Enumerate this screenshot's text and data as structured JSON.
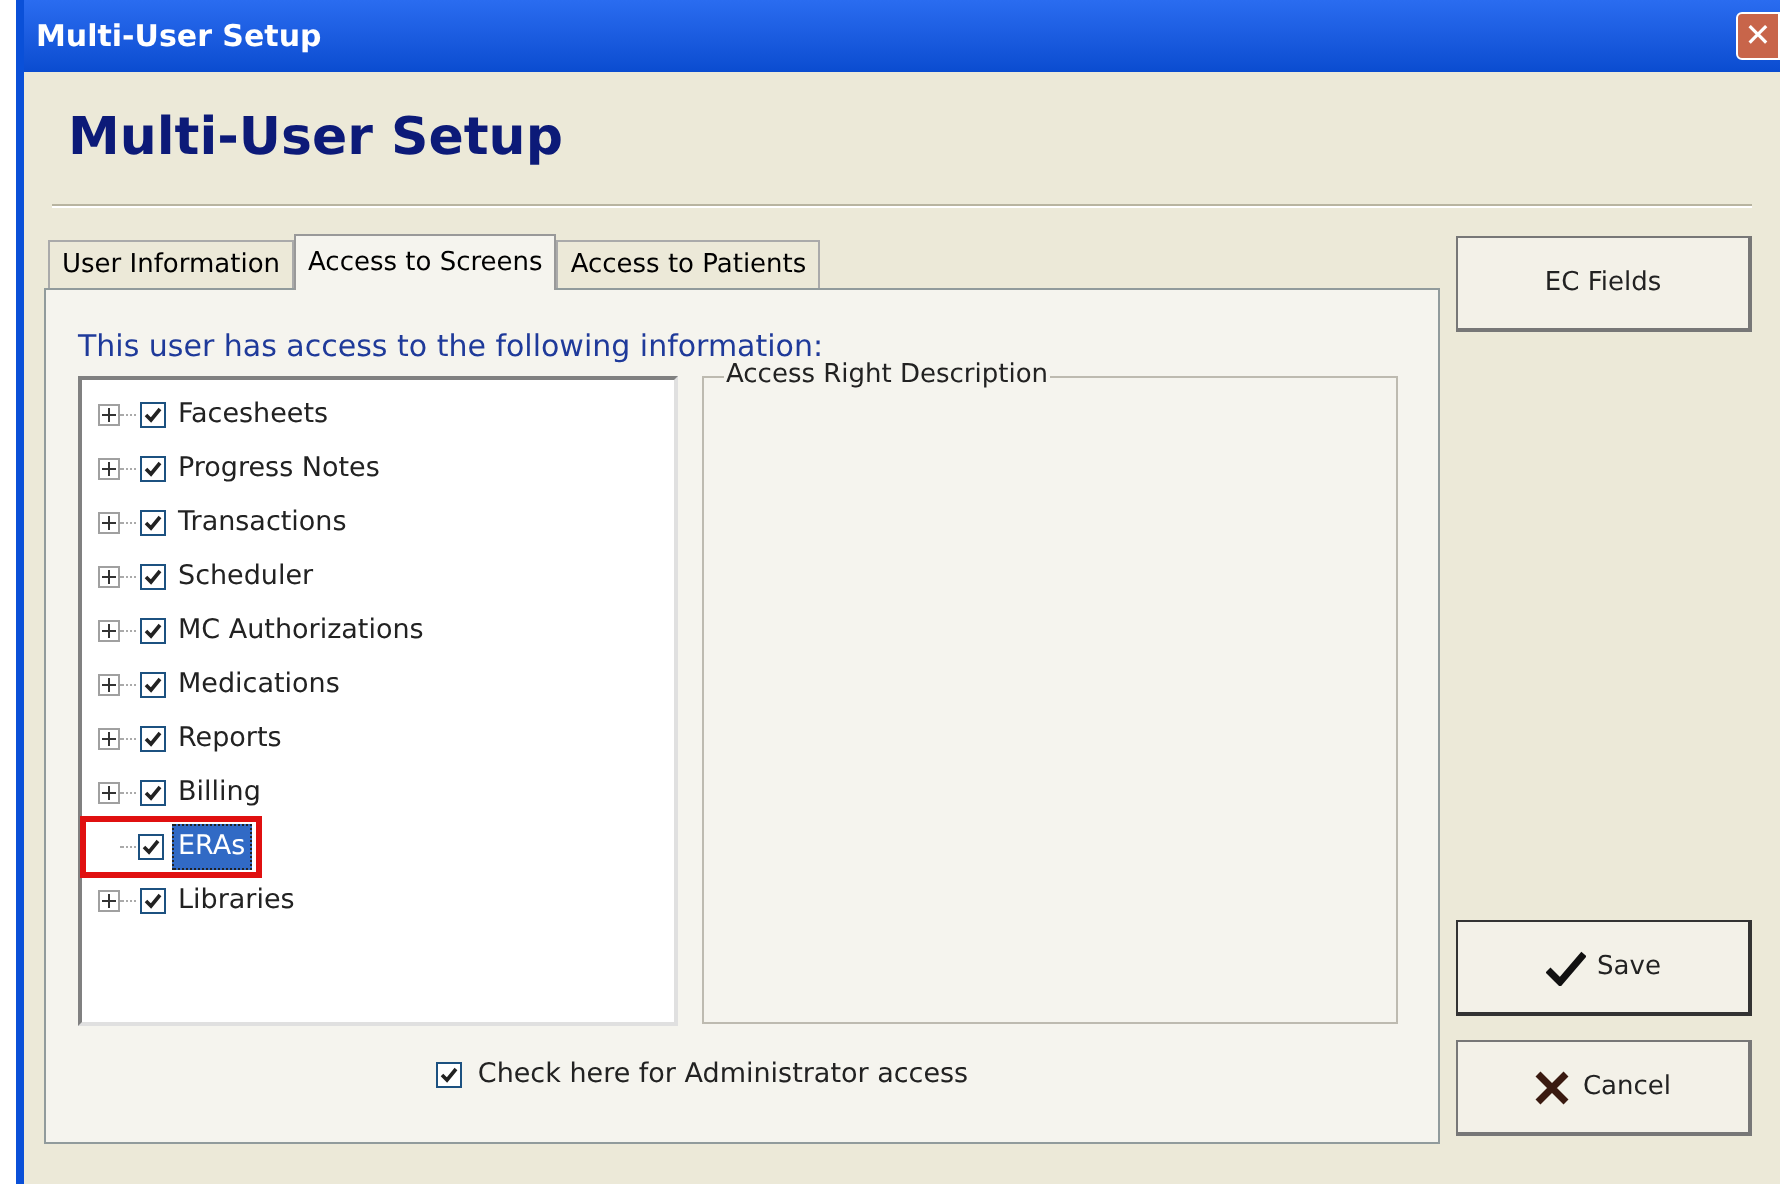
{
  "window": {
    "title": "Multi-User Setup",
    "close": "✕"
  },
  "header": "Multi-User Setup",
  "tabs": [
    {
      "label": "User Information",
      "selected": false
    },
    {
      "label": "Access to Screens",
      "selected": true
    },
    {
      "label": "Access to Patients",
      "selected": false
    }
  ],
  "intro": "This user has access to the following information:",
  "tree": [
    {
      "label": "Facesheets",
      "checked": true,
      "expandable": true,
      "selected": false,
      "outlined": false
    },
    {
      "label": "Progress Notes",
      "checked": true,
      "expandable": true,
      "selected": false,
      "outlined": false
    },
    {
      "label": "Transactions",
      "checked": true,
      "expandable": true,
      "selected": false,
      "outlined": false
    },
    {
      "label": "Scheduler",
      "checked": true,
      "expandable": true,
      "selected": false,
      "outlined": false
    },
    {
      "label": "MC Authorizations",
      "checked": true,
      "expandable": true,
      "selected": false,
      "outlined": false
    },
    {
      "label": "Medications",
      "checked": true,
      "expandable": true,
      "selected": false,
      "outlined": false
    },
    {
      "label": "Reports",
      "checked": true,
      "expandable": true,
      "selected": false,
      "outlined": false
    },
    {
      "label": "Billing",
      "checked": true,
      "expandable": true,
      "selected": false,
      "outlined": false
    },
    {
      "label": "ERAs",
      "checked": true,
      "expandable": false,
      "selected": true,
      "outlined": true
    },
    {
      "label": "Libraries",
      "checked": true,
      "expandable": true,
      "selected": false,
      "outlined": false
    }
  ],
  "description_group": {
    "title": "Access Right Description"
  },
  "admin_checkbox": {
    "label": "Check here for Administrator access",
    "checked": true
  },
  "buttons": [
    {
      "label": "EC Fields",
      "kind": "plain"
    },
    {
      "label": "Save",
      "kind": "save"
    },
    {
      "label": "Cancel",
      "kind": "cancel"
    }
  ]
}
